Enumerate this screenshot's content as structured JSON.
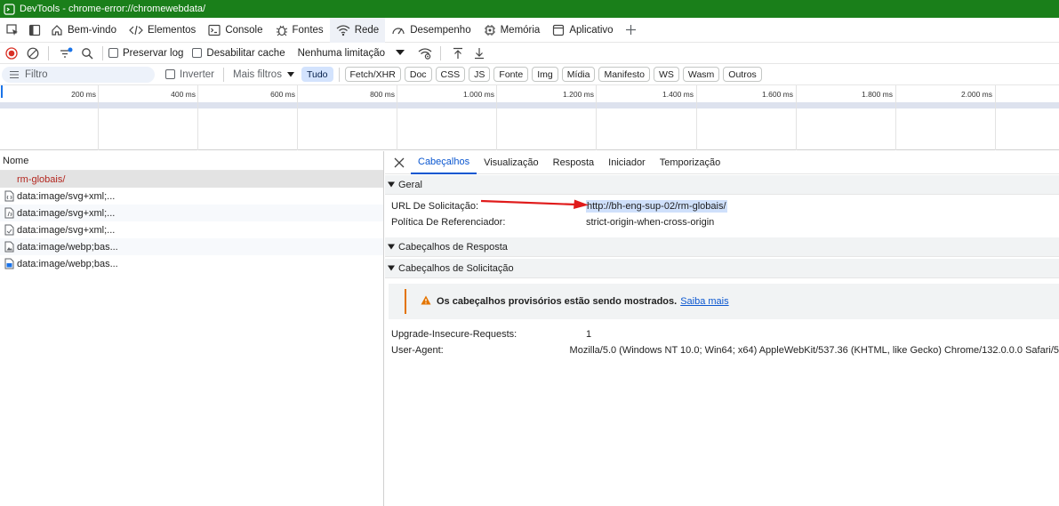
{
  "title_bar": {
    "title": "DevTools - chrome-error://chromewebdata/"
  },
  "main_tabs": [
    {
      "label": "Bem-vindo"
    },
    {
      "label": "Elementos"
    },
    {
      "label": "Console"
    },
    {
      "label": "Fontes"
    },
    {
      "label": "Rede",
      "active": true
    },
    {
      "label": "Desempenho"
    },
    {
      "label": "Memória"
    },
    {
      "label": "Aplicativo"
    }
  ],
  "toolbar": {
    "preserve_log": "Preservar log",
    "disable_cache": "Desabilitar cache",
    "throttling": "Nenhuma limitação"
  },
  "filter_bar": {
    "placeholder": "Filtro",
    "invert": "Inverter",
    "more_filters": "Mais filtros",
    "types": [
      "Tudo",
      "Fetch/XHR",
      "Doc",
      "CSS",
      "JS",
      "Fonte",
      "Img",
      "Mídia",
      "Manifesto",
      "WS",
      "Wasm",
      "Outros"
    ]
  },
  "overview": {
    "ticks": [
      "200 ms",
      "400 ms",
      "600 ms",
      "800 ms",
      "1.000 ms",
      "1.200 ms",
      "1.400 ms",
      "1.600 ms",
      "1.800 ms",
      "2.000 ms"
    ]
  },
  "request_list": {
    "header": "Nome",
    "rows": [
      {
        "name": "rm-globais/",
        "selected": true
      },
      {
        "name": "data:image/svg+xml;..."
      },
      {
        "name": "data:image/svg+xml;..."
      },
      {
        "name": "data:image/svg+xml;..."
      },
      {
        "name": "data:image/webp;bas..."
      },
      {
        "name": "data:image/webp;bas..."
      }
    ]
  },
  "details": {
    "tabs": [
      "Cabeçalhos",
      "Visualização",
      "Resposta",
      "Iniciador",
      "Temporização"
    ],
    "general_title": "Geral",
    "general": [
      {
        "key": "URL De Solicitação:",
        "value": "http://bh-eng-sup-02/rm-globais/"
      },
      {
        "key": "Política De Referenciador:",
        "value": "strict-origin-when-cross-origin"
      }
    ],
    "response_headers_title": "Cabeçalhos de Resposta",
    "request_headers_title": "Cabeçalhos de Solicitação",
    "warning": {
      "message": "Os cabeçalhos provisórios estão sendo mostrados.",
      "link": "Saiba mais"
    },
    "request_headers": [
      {
        "key": "Upgrade-Insecure-Requests:",
        "value": "1"
      },
      {
        "key": "User-Agent:",
        "value": "Mozilla/5.0 (Windows NT 10.0; Win64; x64) AppleWebKit/537.36 (KHTML, like Gecko) Chrome/132.0.0.0 Safari/5"
      }
    ]
  },
  "colors": {
    "title_bar": "#1a7f1a",
    "accent": "#0b57d0",
    "selected_request": "#b3261e",
    "warning": "#e37400",
    "annotation_arrow": "#e01b1b"
  }
}
